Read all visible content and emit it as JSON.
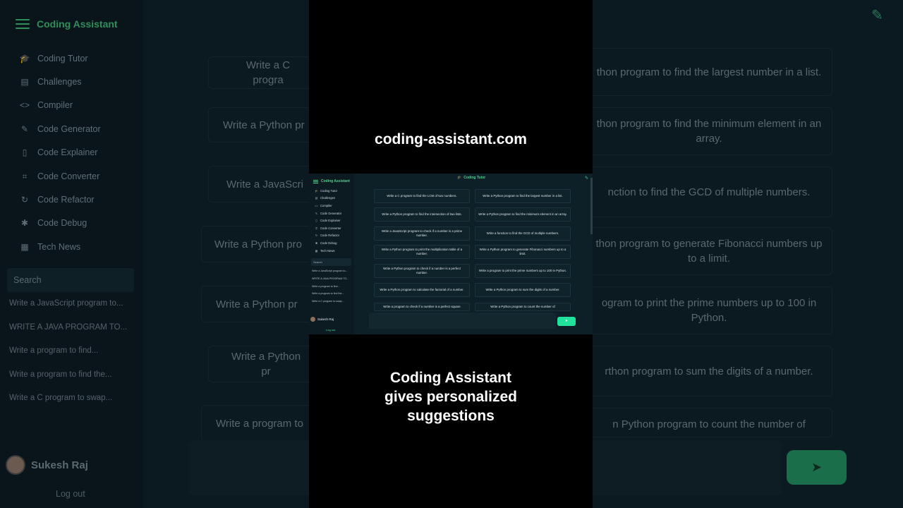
{
  "app": {
    "brand": "Coding Assistant",
    "header_title": "Coding Tutor"
  },
  "sidebar": {
    "items": [
      {
        "label": "Coding Tutor",
        "icon": "graduation-cap-icon"
      },
      {
        "label": "Challenges",
        "icon": "clipboard-icon"
      },
      {
        "label": "Compiler",
        "icon": "code-icon"
      },
      {
        "label": "Code Generator",
        "icon": "wrench-icon"
      },
      {
        "label": "Code Explainer",
        "icon": "document-icon"
      },
      {
        "label": "Code Converter",
        "icon": "crop-icon"
      },
      {
        "label": "Code Refactor",
        "icon": "refresh-icon"
      },
      {
        "label": "Code Debug",
        "icon": "bug-icon"
      },
      {
        "label": "Tech News",
        "icon": "newspaper-icon"
      }
    ],
    "search_placeholder": "Search",
    "history": [
      "Write a JavaScript program to...",
      "WRITE A JAVA PROGRAM TO...",
      "Write a program to find...",
      "Write a program to find the...",
      "Write a C program to swap..."
    ],
    "user_name": "Sukesh Raj",
    "logout_label": "Log out"
  },
  "mini_history": [
    "Write a JavaScript program to...",
    "WRITE A JAVA PROGRAM TO...",
    "Write a program to find...",
    "Write a program to find the...",
    "Write a C program to swap..."
  ],
  "suggestions": [
    "Write a C program to find the LCM of two numbers.",
    "Write a Python program to find the largest number in a list.",
    "Write a Python program to find the intersection of two lists.",
    "Write a Python program to find the minimum element in an array.",
    "Write a JavaScript program to check if a number is a prime number.",
    "Write a function to find the GCD of multiple numbers.",
    "Write a Python program to print the multiplication table of a number.",
    "Write a Python program to generate Fibonacci numbers up to a limit.",
    "Write a Python program to check if a number is a perfect number.",
    "Write a program to print the prime numbers up to 100 in Python.",
    "Write a Python program to calculate the factorial of a number.",
    "Write a Python program to sum the digits of a number.",
    "Write a program to check if a number is a perfect square",
    "Write a Python program to count the number of"
  ],
  "background_cards": {
    "left": [
      "Write a C progra",
      "Write a Python pr",
      "Write a JavaScri",
      "Write a Python pro",
      "Write a Python pr",
      "Write a Python pr",
      "Write a program to"
    ],
    "right": [
      "thon program to find the largest number in a list.",
      "thon program to find the minimum element in an array.",
      "nction to find the GCD of multiple numbers.",
      "thon program to generate Fibonacci numbers up to a limit.",
      "ogram to print the prime numbers up to 100 in Python.",
      "rthon program to sum the digits of a number.",
      "n Python program to count the number of"
    ]
  },
  "captions": {
    "top": "coding-assistant.com",
    "bottom_line1": "Coding Assistant",
    "bottom_line2": "gives personalized",
    "bottom_line3": "suggestions"
  },
  "send_icon": "send-arrow-icon",
  "colors": {
    "accent": "#1fe39a",
    "brand_green": "#4fd18a"
  }
}
